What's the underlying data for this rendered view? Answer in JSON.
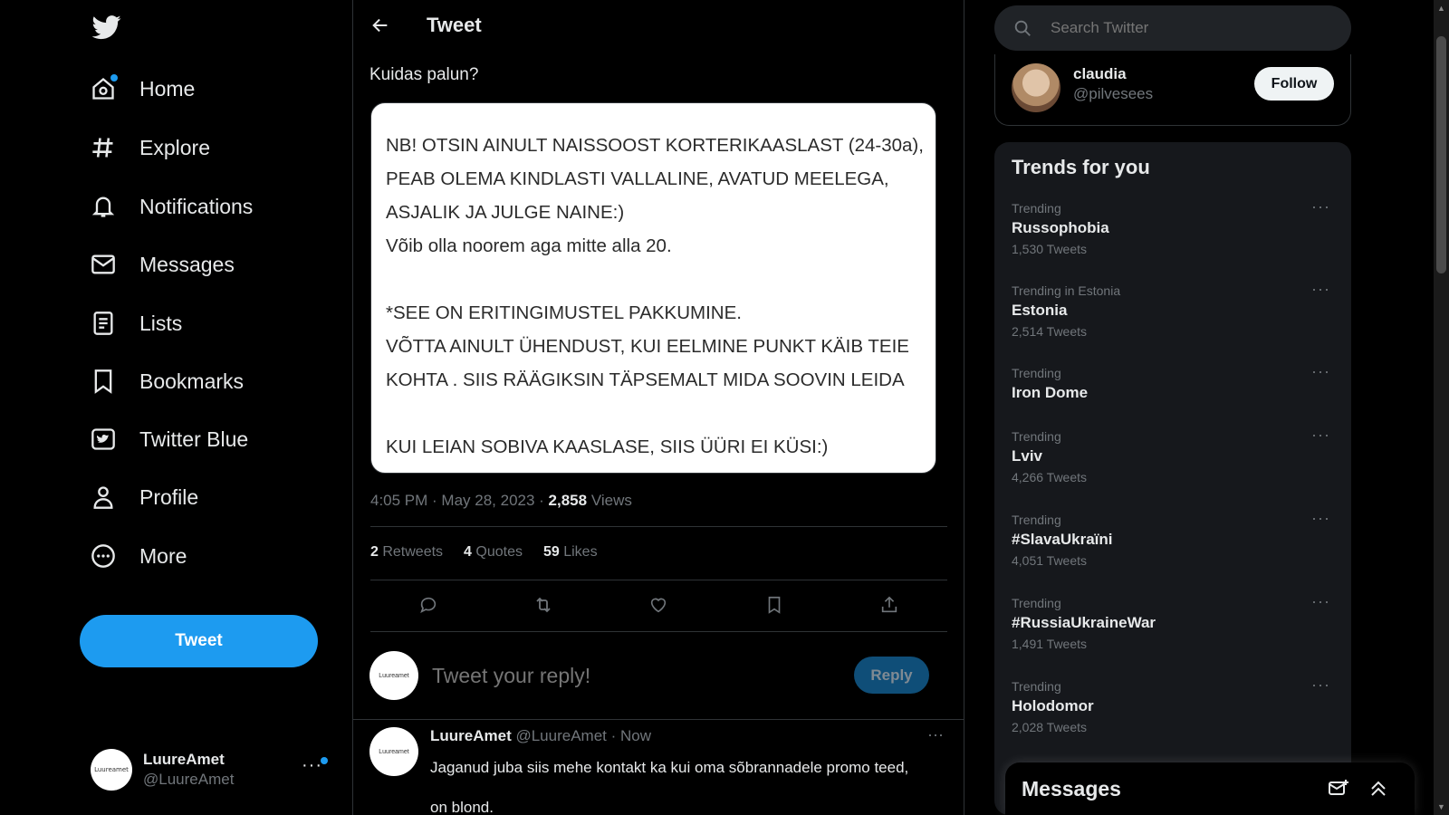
{
  "nav": {
    "items": [
      {
        "label": "Home",
        "icon": "home-icon"
      },
      {
        "label": "Explore",
        "icon": "hashtag-icon"
      },
      {
        "label": "Notifications",
        "icon": "bell-icon"
      },
      {
        "label": "Messages",
        "icon": "envelope-icon"
      },
      {
        "label": "Lists",
        "icon": "list-icon"
      },
      {
        "label": "Bookmarks",
        "icon": "bookmark-icon"
      },
      {
        "label": "Twitter Blue",
        "icon": "twitter-blue-icon"
      },
      {
        "label": "Profile",
        "icon": "person-icon"
      },
      {
        "label": "More",
        "icon": "more-circle-icon"
      }
    ],
    "tweet_button": "Tweet"
  },
  "account": {
    "name": "LuureAmet",
    "handle": "@LuureAmet",
    "avatar_text": "Luureamet"
  },
  "header": {
    "title": "Tweet"
  },
  "tweet": {
    "text": "Kuidas palun?",
    "image_lines": [
      "NB! OTSIN AINULT NAISSOOST KORTERIKAASLAST (24-30a),",
      "PEAB OLEMA KINDLASTI VALLALINE, AVATUD MEELEGA,",
      "ASJALIK JA JULGE NAINE:)",
      "Võib olla noorem aga mitte alla 20.",
      "",
      "*SEE ON ERITINGIMUSTEL PAKKUMINE.",
      "VÕTTA AINULT ÜHENDUST, KUI EELMINE PUNKT KÄIB TEIE",
      "KOHTA . SIIS RÄÄGIKSIN TÄPSEMALT MIDA SOOVIN LEIDA",
      "",
      "KUI LEIAN SOBIVA KAASLASE, SIIS ÜÜRI EI KÜSI:)"
    ],
    "time": "4:05 PM · May 28, 2023 · ",
    "views_count": "2,858",
    "views_label": " Views",
    "retweets": "2",
    "retweets_label": " Retweets",
    "quotes": "4",
    "quotes_label": " Quotes",
    "likes": "59",
    "likes_label": " Likes"
  },
  "reply_box": {
    "placeholder": "Tweet your reply!",
    "button": "Reply"
  },
  "reply": {
    "name": "LuureAmet",
    "handle": " @LuureAmet · Now",
    "line1": "Jaganud juba siis mehe kontakt ka kui oma sõbrannadele promo teed,",
    "line2": "on blond."
  },
  "search": {
    "placeholder": "Search Twitter"
  },
  "who_to_follow": {
    "name": "claudia",
    "handle": "@pilvesees",
    "button": "Follow"
  },
  "trends": {
    "title": "Trends for you",
    "items": [
      {
        "context": "Trending",
        "name": "Russophobia",
        "count": "1,530 Tweets"
      },
      {
        "context": "Trending in Estonia",
        "name": "Estonia",
        "count": "2,514 Tweets"
      },
      {
        "context": "Trending",
        "name": "Iron Dome",
        "count": ""
      },
      {
        "context": "Trending",
        "name": "Lviv",
        "count": "4,266 Tweets"
      },
      {
        "context": "Trending",
        "name": "#SlavaUkraïni",
        "count": "4,051 Tweets"
      },
      {
        "context": "Trending",
        "name": "#RussiaUkraineWar",
        "count": "1,491 Tweets"
      },
      {
        "context": "Trending",
        "name": "Holodomor",
        "count": "2,028 Tweets"
      }
    ]
  },
  "messages_drawer": {
    "title": "Messages"
  },
  "colors": {
    "accent": "#1d9bf0",
    "background": "#000000",
    "text": "#e7e9ea",
    "muted": "#71767b"
  }
}
